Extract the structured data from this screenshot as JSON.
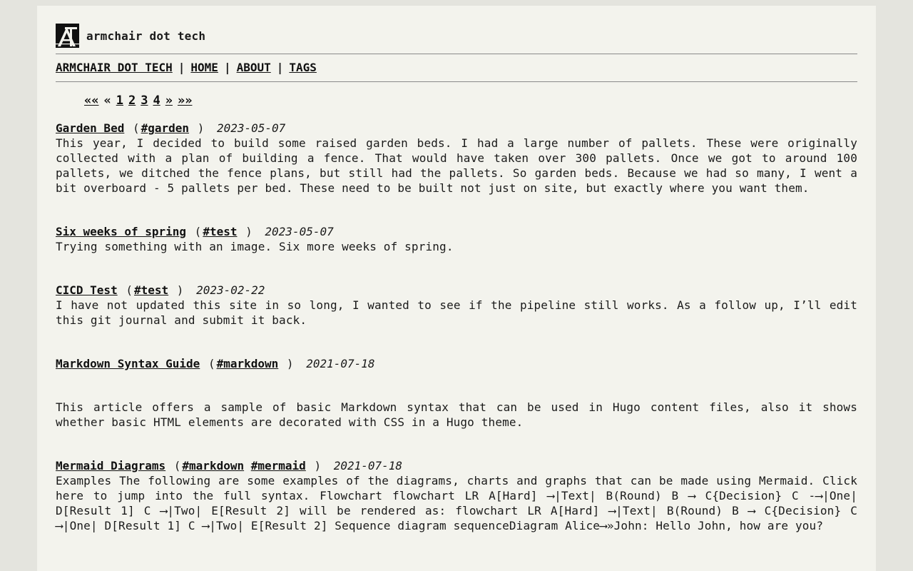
{
  "site": {
    "title": "armchair dot tech",
    "logo_icon": "armchair-tech-logo-icon"
  },
  "nav": {
    "items": [
      {
        "label": "ARMCHAIR DOT TECH"
      },
      {
        "label": "HOME"
      },
      {
        "label": "ABOUT"
      },
      {
        "label": "TAGS"
      }
    ],
    "separator": "|"
  },
  "pager": {
    "first": "««",
    "prev": "«",
    "pages": [
      "1",
      "2",
      "3",
      "4"
    ],
    "next": "»",
    "last": "»»"
  },
  "posts": [
    {
      "title": "Garden Bed",
      "tags": [
        "#garden"
      ],
      "date": "2023-05-07",
      "summary": "This year, I decided to build some raised garden beds. I had a large number of pallets. These were originally collected with a plan of building a fence. That would have taken over 300 pallets. Once we got to around 100 pallets, we ditched the fence plans, but still had the pallets. So garden beds. Because we had so many, I went a bit overboard - 5 pallets per bed. These need to be built not just on site, but exactly where you want them."
    },
    {
      "title": "Six weeks of spring",
      "tags": [
        "#test"
      ],
      "date": "2023-05-07",
      "summary": "Trying something with an image. Six more weeks of spring."
    },
    {
      "title": "CICD Test",
      "tags": [
        "#test"
      ],
      "date": "2023-02-22",
      "summary": "I have not updated this site in so long, I wanted to see if the pipeline still works. As a follow up, I’ll edit this git journal and submit it back."
    },
    {
      "title": "Markdown Syntax Guide",
      "tags": [
        "#markdown"
      ],
      "date": "2021-07-18",
      "summary": "This article offers a sample of basic Markdown syntax that can be used in Hugo content files, also it shows whether basic HTML elements are decorated with CSS in a Hugo theme."
    },
    {
      "title": "Mermaid Diagrams",
      "tags": [
        "#markdown",
        "#mermaid"
      ],
      "date": "2021-07-18",
      "summary": "Examples The following are some examples of the diagrams, charts and graphs that can be made using Mermaid. Click here to jump into the full syntax. Flowchart flowchart LR A[Hard] ⟶|Text| B(Round) B ⟶ C{Decision} C -⟶|One| D[Result 1] C ⟶|Two| E[Result 2] will be rendered as: flowchart LR A[Hard] ⟶|Text| B(Round) B ⟶ C{Decision} C ⟶|One| D[Result 1] C ⟶|Two| E[Result 2] Sequence diagram sequenceDiagram Alice⟶»John: Hello John, how are you?"
    }
  ]
}
